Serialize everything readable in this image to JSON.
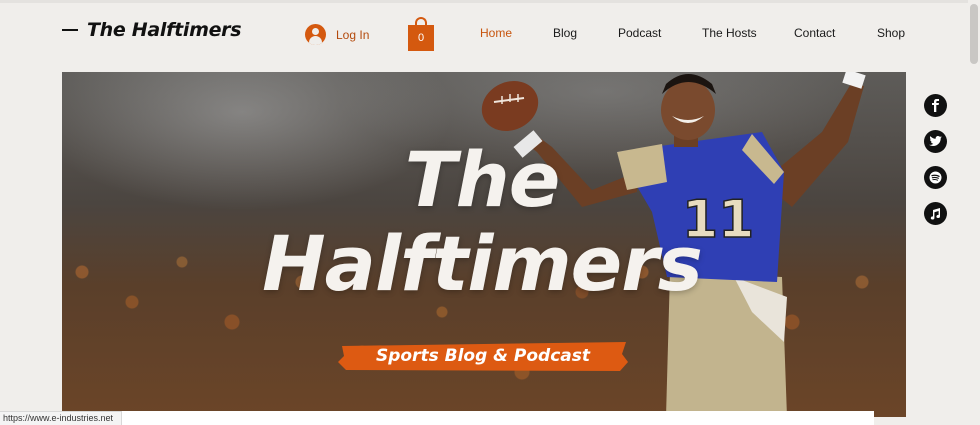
{
  "brand": {
    "name": "The Halftimers"
  },
  "header": {
    "login_label": "Log In",
    "cart_count": "0",
    "accent_color": "#d4590f"
  },
  "nav": {
    "items": [
      {
        "label": "Home",
        "active": true
      },
      {
        "label": "Blog"
      },
      {
        "label": "Podcast"
      },
      {
        "label": "The Hosts"
      },
      {
        "label": "Contact"
      },
      {
        "label": "Shop"
      }
    ]
  },
  "hero": {
    "title_line1": "The",
    "title_line2": "Halftimers",
    "subtitle": "Sports Blog & Podcast",
    "jersey_number": "11"
  },
  "social": {
    "icons": [
      "facebook-icon",
      "twitter-icon",
      "spotify-icon",
      "music-note-icon"
    ]
  },
  "status_bar": {
    "url": "https://www.e-industries.net"
  }
}
